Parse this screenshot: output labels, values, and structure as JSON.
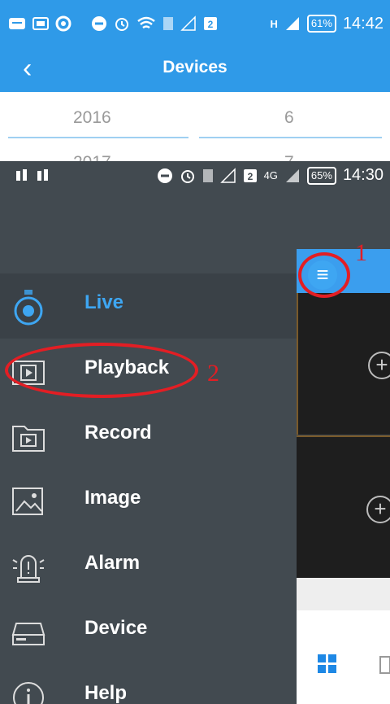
{
  "top_screenshot": {
    "status_bar": {
      "signal_type": "H",
      "battery": "61%",
      "time": "14:42"
    },
    "header": {
      "title": "Devices"
    },
    "picker": [
      {
        "year": "2016",
        "month": "6"
      },
      {
        "year": "2017",
        "month": "7"
      }
    ]
  },
  "bottom_screenshot": {
    "status_bar": {
      "network": "4G",
      "battery": "65%",
      "time": "14:30"
    },
    "menu": [
      {
        "label": "Live",
        "icon": "camera-icon"
      },
      {
        "label": "Playback",
        "icon": "playback-icon"
      },
      {
        "label": "Record",
        "icon": "record-folder-icon"
      },
      {
        "label": "Image",
        "icon": "image-icon"
      },
      {
        "label": "Alarm",
        "icon": "alarm-icon"
      },
      {
        "label": "Device",
        "icon": "device-icon"
      },
      {
        "label": "Help",
        "icon": "info-icon"
      }
    ],
    "annotations": {
      "first": "1",
      "second": "2"
    },
    "colors": {
      "accent": "#3ea6f2",
      "annotation": "#e31e24",
      "drawer": "#424a50"
    }
  }
}
